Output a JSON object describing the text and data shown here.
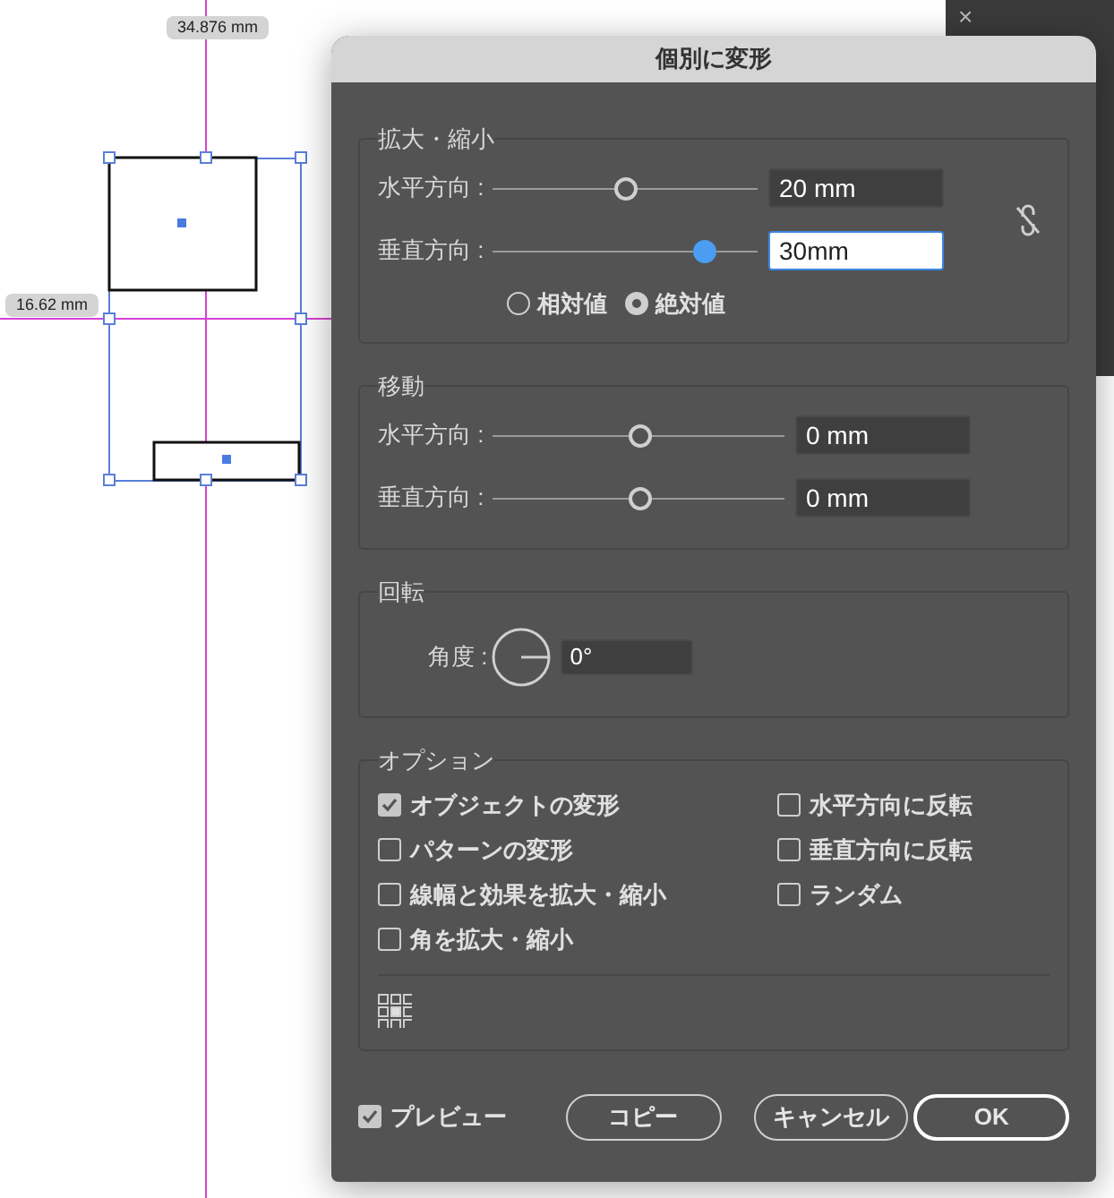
{
  "canvas": {
    "guide_labels": [
      "34.876 mm",
      "16.62 mm"
    ]
  },
  "side_panel": {
    "close": "×"
  },
  "dialog": {
    "title": "個別に変形",
    "scale": {
      "title": "拡大・縮小",
      "rows": [
        {
          "label": "水平方向 :",
          "level": 0.5,
          "value": "20 mm",
          "focused": false
        },
        {
          "label": "垂直方向 :",
          "level": 0.8,
          "value": "30mm",
          "focused": true
        }
      ],
      "modes": [
        {
          "label": "相対値",
          "selected": false
        },
        {
          "label": "絶対値",
          "selected": true
        }
      ]
    },
    "move": {
      "title": "移動",
      "rows": [
        {
          "label": "水平方向 :",
          "level": 0.5,
          "value": "0 mm",
          "focused": false
        },
        {
          "label": "垂直方向 :",
          "level": 0.5,
          "value": "0 mm",
          "focused": false
        }
      ]
    },
    "rotate": {
      "title": "回転",
      "label": "角度 :",
      "value": "0°"
    },
    "options": {
      "title": "オプション",
      "items": [
        {
          "label": "オブジェクトの変形",
          "checked": true
        },
        {
          "label": "パターンの変形",
          "checked": false
        },
        {
          "label": "線幅と効果を拡大・縮小",
          "checked": false
        },
        {
          "label": "角を拡大・縮小",
          "checked": false
        },
        {
          "label": "水平方向に反転",
          "checked": false
        },
        {
          "label": "垂直方向に反転",
          "checked": false
        },
        {
          "label": "ランダム",
          "checked": false
        }
      ]
    },
    "preview": {
      "label": "プレビュー",
      "checked": true
    },
    "buttons": [
      {
        "label": "コピー",
        "default": false
      },
      {
        "label": "キャンセル",
        "default": false
      },
      {
        "label": "OK",
        "default": true
      }
    ]
  }
}
